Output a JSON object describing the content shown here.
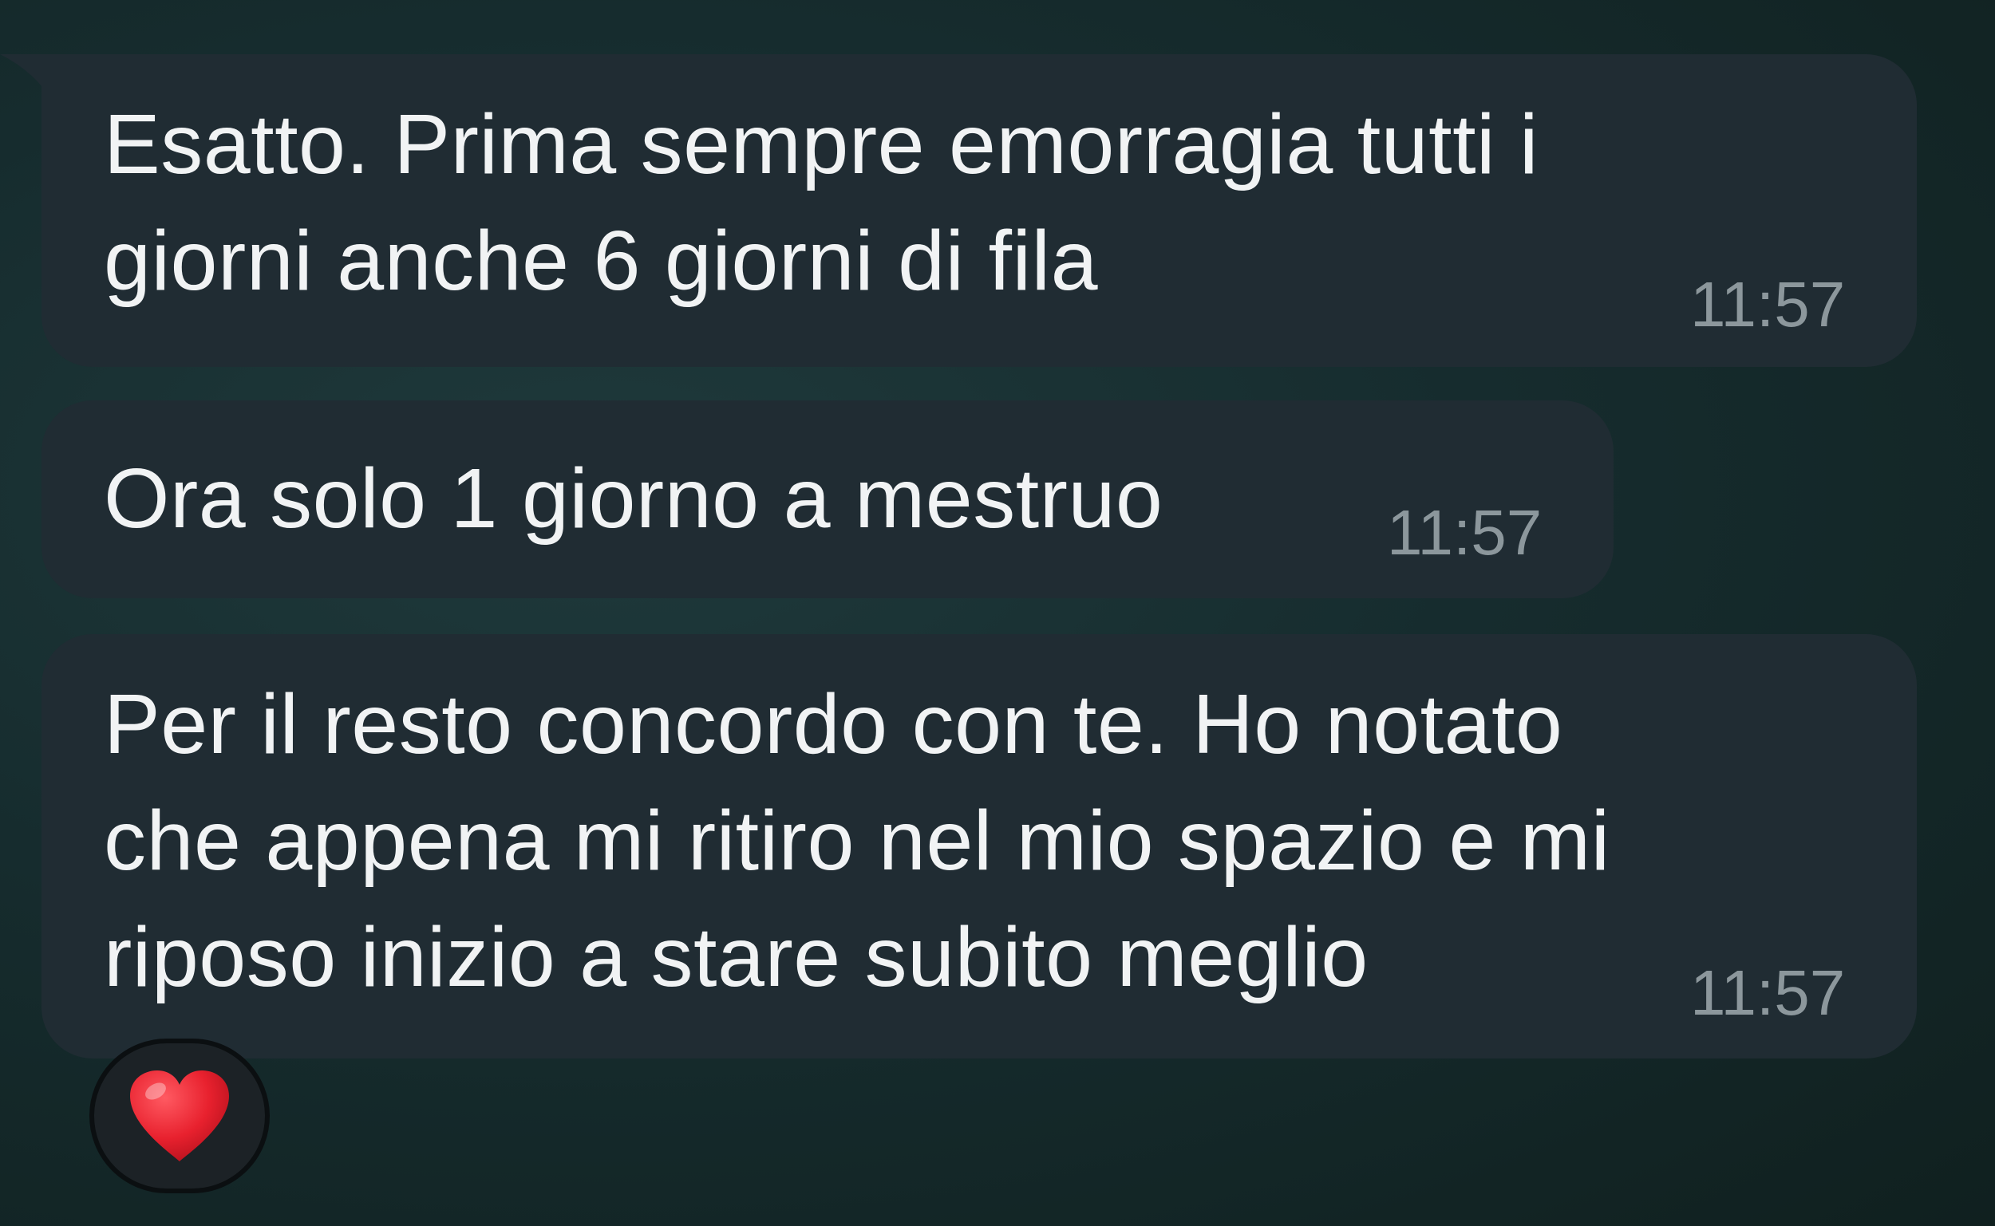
{
  "messages": [
    {
      "text": "Esatto. Prima sempre emorragia tutti i\ngiorni anche 6 giorni di fila",
      "time": "11:57"
    },
    {
      "text": "Ora solo 1 giorno a mestruo",
      "time": "11:57"
    },
    {
      "text": "Per il resto concordo con te. Ho notato\nche appena mi ritiro nel mio spazio e mi\nriposo inizio a stare subito meglio",
      "time": "11:57"
    }
  ],
  "reaction": {
    "icon": "heart-icon",
    "color": "#e8212e"
  },
  "colors": {
    "bubble": "#202c33",
    "text": "#f1f3f4",
    "time": "#8c979c"
  }
}
